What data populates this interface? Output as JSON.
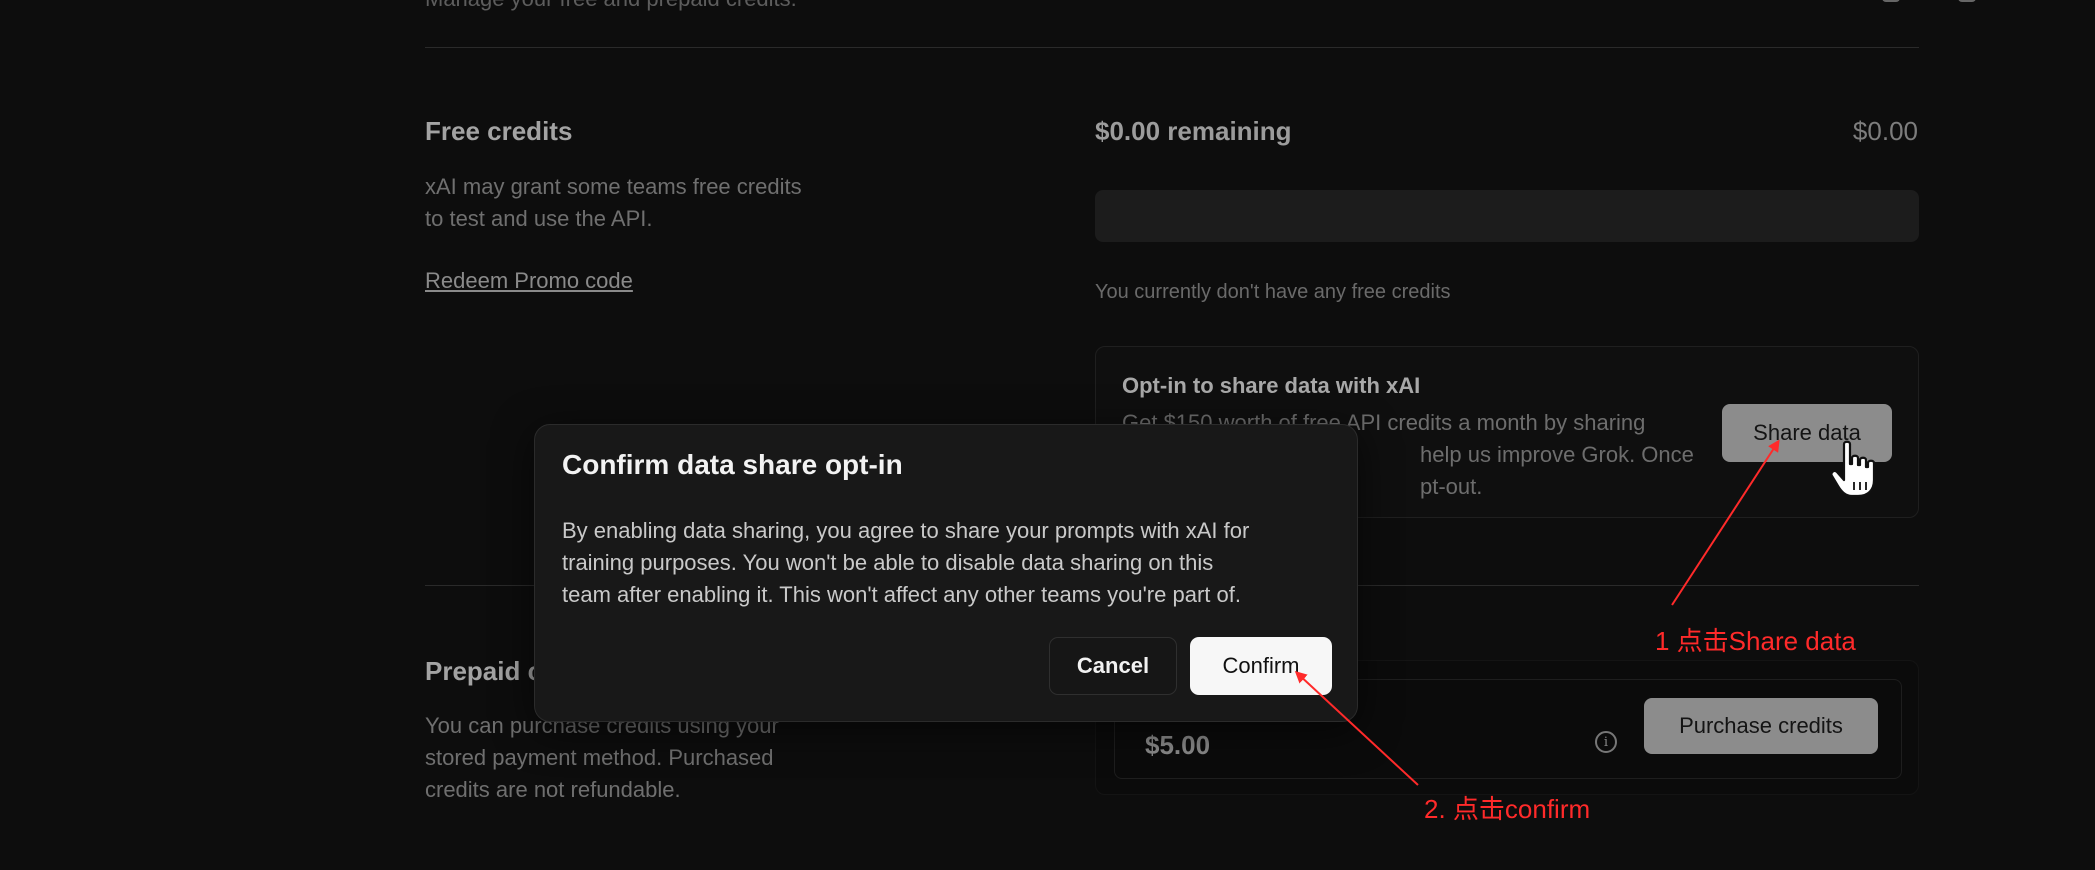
{
  "header": {
    "subtitle": "Manage your free and prepaid credits."
  },
  "free_credits": {
    "title": "Free credits",
    "description_line1": "xAI may grant some teams free credits",
    "description_line2": "to test and use the API.",
    "promo_link": "Redeem Promo code",
    "remaining_label": "$0.00 remaining",
    "remaining_amount": "$0.00",
    "progress_fraction": 0,
    "no_credits_text": "You currently don't have any free credits"
  },
  "optin": {
    "title": "Opt-in to share data with xAI",
    "desc_line1": "Get $150 worth of free API credits a month by sharing",
    "desc_line2_visible": "help us improve Grok. Once",
    "desc_line3_visible": "pt-out.",
    "share_button": "Share data"
  },
  "prepaid": {
    "title_visible": "Prepaid c",
    "desc_line1": "You can purchase credits using your",
    "desc_line2": "stored payment method. Purchased",
    "desc_line3": "credits are not refundable.",
    "amount": "$5.00",
    "purchase_button": "Purchase credits",
    "info_icon": "info-icon"
  },
  "modal": {
    "title": "Confirm data share opt-in",
    "body_line1": "By enabling data sharing, you agree to share your prompts with xAI for",
    "body_line2": "training purposes. You won't be able to disable data sharing on this",
    "body_line3": "team after enabling it. This won't affect any other teams you're part of.",
    "cancel_label": "Cancel",
    "confirm_label": "Confirm"
  },
  "annotations": {
    "step1": "1 点击Share data",
    "step2": "2. 点击confirm",
    "color": "#ff2a2a"
  },
  "theme": {
    "background": "#0d0d0d",
    "modal_bg": "#181818",
    "button_gray": "#8c8c8c",
    "confirm_bg": "#f7f7f7"
  }
}
